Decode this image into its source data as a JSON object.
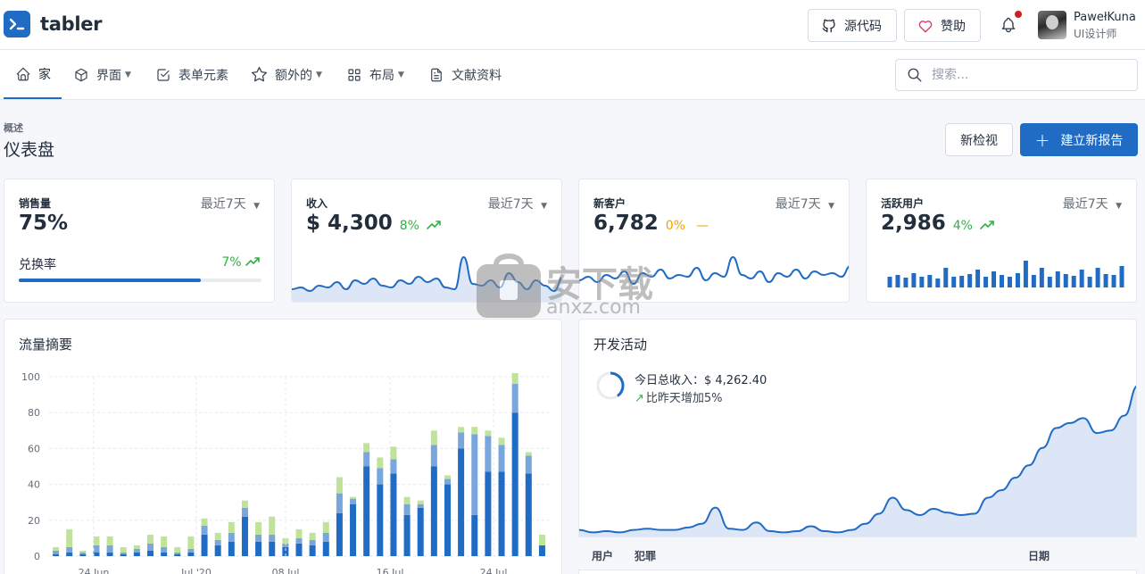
{
  "header": {
    "logo_text": "tabler",
    "source_btn": "源代码",
    "sponsor_btn": "赞助",
    "user_name": "PawełKuna",
    "user_role": "UI设计师"
  },
  "nav": {
    "items": [
      {
        "label": "家",
        "icon": "home-icon"
      },
      {
        "label": "界面",
        "icon": "package-icon"
      },
      {
        "label": "表单元素",
        "icon": "checkbox-icon"
      },
      {
        "label": "额外的",
        "icon": "star-icon"
      },
      {
        "label": "布局",
        "icon": "layout-icon"
      },
      {
        "label": "文献资料",
        "icon": "file-icon"
      }
    ],
    "search_placeholder": "搜索..."
  },
  "page": {
    "pretitle": "概述",
    "title": "仪表盘",
    "new_view": "新检视",
    "create_report": "建立新报告"
  },
  "cards": {
    "sales": {
      "label": "销售量",
      "period": "最近7天",
      "value": "75%",
      "conv_label": "兑换率",
      "conv_pct": "7%",
      "progress": 0.75
    },
    "revenue": {
      "label": "收入",
      "period": "最近7天",
      "value": "$ 4,300",
      "trend": "8%"
    },
    "clients": {
      "label": "新客户",
      "period": "最近7天",
      "value": "6,782",
      "trend": "0%"
    },
    "active": {
      "label": "活跃用户",
      "period": "最近7天",
      "value": "2,986",
      "trend": "4%"
    }
  },
  "traffic": {
    "title": "流量摘要"
  },
  "dev": {
    "title": "开发活动",
    "income_line": "今日总收入：$ 4,262.40",
    "compare_line": "比昨天增加5%",
    "columns": {
      "user": "用户",
      "commit": "犯罪",
      "date": "日期"
    }
  },
  "watermark": {
    "text": "安下载",
    "sub": "anxz.com"
  },
  "chart_data": [
    {
      "type": "bar",
      "title": "流量摘要",
      "ylim": [
        0,
        100
      ],
      "yticks": [
        0,
        20,
        40,
        60,
        80,
        100
      ],
      "series": [
        {
          "values": [
            1,
            2,
            1,
            2,
            2,
            1,
            2,
            3,
            2,
            1,
            2,
            12,
            6,
            8,
            22,
            8,
            8,
            5,
            7,
            6,
            8,
            24,
            29,
            50,
            40,
            46,
            23,
            27,
            50,
            40,
            60,
            23,
            47,
            47,
            80,
            46,
            6
          ]
        },
        {
          "values": [
            2,
            3,
            1,
            4,
            4,
            1,
            2,
            4,
            3,
            1,
            2,
            5,
            3,
            5,
            5,
            4,
            4,
            2,
            3,
            3,
            5,
            11,
            3,
            8,
            9,
            8,
            6,
            2,
            12,
            3,
            9,
            45,
            20,
            15,
            16,
            10,
            0
          ]
        },
        {
          "values": [
            2,
            10,
            1,
            5,
            5,
            3,
            2,
            5,
            6,
            3,
            7,
            4,
            4,
            6,
            4,
            7,
            10,
            3,
            5,
            4,
            6,
            9,
            1,
            5,
            6,
            7,
            4,
            2,
            8,
            2,
            3,
            4,
            3,
            4,
            6,
            2,
            6
          ]
        }
      ],
      "xticks": [
        "24 Jun",
        "Jul '20",
        "08 Jul",
        "16 Jul",
        "24 Jul"
      ]
    },
    {
      "type": "line",
      "name": "revenue",
      "values": [
        37,
        38,
        36,
        39,
        38,
        41,
        37,
        42,
        40,
        43,
        39,
        38,
        42,
        40,
        44,
        41,
        43,
        38,
        37,
        55,
        40,
        39,
        42,
        38,
        46,
        41,
        37,
        42,
        39,
        36,
        44
      ]
    },
    {
      "type": "line",
      "name": "new-clients",
      "values": [
        42,
        44,
        41,
        45,
        43,
        47,
        40,
        46,
        44,
        48,
        43,
        45,
        44,
        49,
        42,
        46,
        44,
        55,
        45,
        43,
        47,
        41,
        46,
        44,
        48,
        43,
        47,
        45,
        46,
        44,
        50
      ]
    },
    {
      "type": "bar",
      "name": "active-users",
      "values": [
        12,
        14,
        11,
        16,
        12,
        14,
        10,
        22,
        12,
        13,
        15,
        20,
        12,
        18,
        14,
        12,
        16,
        30,
        14,
        22,
        12,
        18,
        15,
        13,
        20,
        12,
        22,
        15,
        14,
        24
      ]
    },
    {
      "type": "area",
      "name": "dev-activity",
      "values": [
        6,
        4,
        5,
        4,
        6,
        7,
        6,
        6,
        8,
        11,
        24,
        7,
        6,
        12,
        5,
        4,
        5,
        9,
        5,
        4,
        6,
        11,
        19,
        32,
        22,
        18,
        23,
        20,
        18,
        19,
        32,
        38,
        48,
        58,
        72,
        88,
        92,
        96,
        84,
        86,
        98,
        122
      ]
    }
  ]
}
